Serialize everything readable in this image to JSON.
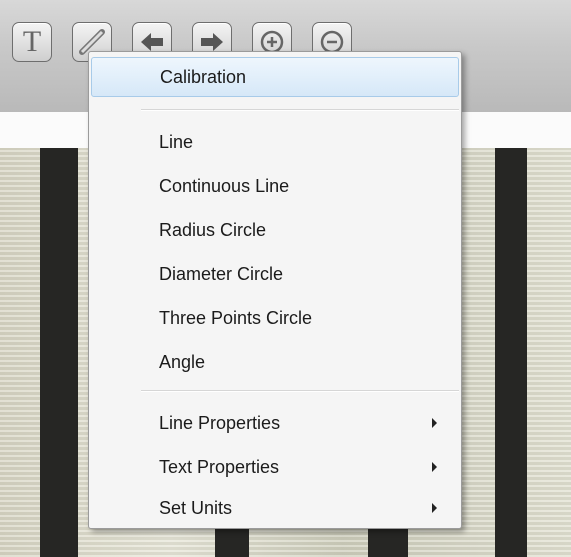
{
  "toolbar": {
    "buttons": [
      {
        "icon": "text-tool-icon",
        "glyph": "T"
      },
      {
        "icon": "measure-tool-icon"
      },
      {
        "icon": "undo-arrow-icon"
      },
      {
        "icon": "redo-arrow-icon"
      },
      {
        "icon": "zoom-in-icon"
      },
      {
        "icon": "zoom-out-icon"
      }
    ]
  },
  "menu": {
    "items": [
      {
        "label": "Calibration",
        "highlighted": true
      },
      {
        "label": "Line"
      },
      {
        "label": "Continuous Line"
      },
      {
        "label": "Radius Circle"
      },
      {
        "label": "Diameter Circle"
      },
      {
        "label": "Three Points Circle"
      },
      {
        "label": "Angle"
      },
      {
        "label": "Line Properties",
        "submenu": true
      },
      {
        "label": "Text Properties",
        "submenu": true
      },
      {
        "label": "Set Units",
        "submenu": true
      }
    ]
  },
  "colors": {
    "highlight": "#d6e8f8",
    "menu_bg": "#f5f5f5",
    "toolbar_bg": "#c9c9c9"
  }
}
